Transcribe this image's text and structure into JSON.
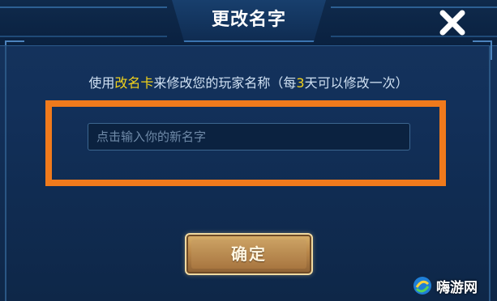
{
  "dialog": {
    "title": "更改名字",
    "hint": {
      "prefix": "使用",
      "item": "改名卡",
      "middle": "来修改您的玩家名称（每",
      "days": "3",
      "suffix": "天可以修改一次）"
    },
    "name_input": {
      "value": "",
      "placeholder": "点击输入你的新名字"
    },
    "confirm_label": "确定",
    "close_icon": "close-icon"
  },
  "watermark": {
    "text": "嗨游网",
    "logo_icon": "swirl-logo-icon"
  },
  "colors": {
    "highlight_orange": "#f07a1c",
    "hint_accent_yellow": "#f2d21b",
    "panel_blue": "#12305a"
  }
}
